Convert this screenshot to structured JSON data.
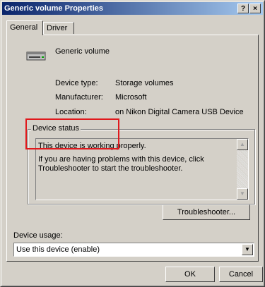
{
  "window": {
    "title": "Generic volume Properties"
  },
  "titlebar": {
    "help": "?",
    "close": "×"
  },
  "tabs": [
    {
      "label": "General",
      "active": true
    },
    {
      "label": "Driver",
      "active": false
    }
  ],
  "device": {
    "name": "Generic volume",
    "icon": "drive-icon",
    "type_label": "Device type:",
    "type_value": "Storage volumes",
    "manufacturer_label": "Manufacturer:",
    "manufacturer_value": "Microsoft",
    "location_label": "Location:",
    "location_value": "on Nikon Digital Camera USB Device"
  },
  "status": {
    "legend": "Device status",
    "line1": "This device is working properly.",
    "line2": "If you are having problems with this device, click Troubleshooter to start the troubleshooter."
  },
  "buttons": {
    "troubleshooter": "Troubleshooter...",
    "ok": "OK",
    "cancel": "Cancel"
  },
  "usage": {
    "label": "Device usage:",
    "selected": "Use this device (enable)"
  },
  "colors": {
    "highlight": "#e0191d",
    "title_start": "#0a246a"
  }
}
